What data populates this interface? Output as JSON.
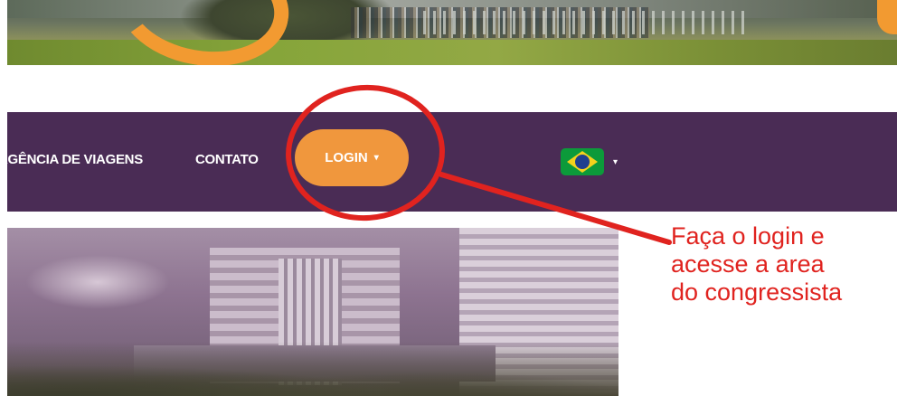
{
  "nav": {
    "items": [
      {
        "label": "AGÊNCIA DE VIAGENS"
      },
      {
        "label": "CONTATO"
      }
    ],
    "login": {
      "label": "LOGIN",
      "caret": "▾"
    },
    "language": {
      "flag_icon": "brazil-flag-icon",
      "caret": "▾"
    }
  },
  "annotation": {
    "callout_lines": [
      "Faça o login e",
      "acesse a area",
      "do congressista"
    ],
    "color": "#e0231f"
  },
  "colors": {
    "nav_background": "#4a2c55",
    "login_button": "#f0973d",
    "brand_orange": "#f29a31"
  }
}
